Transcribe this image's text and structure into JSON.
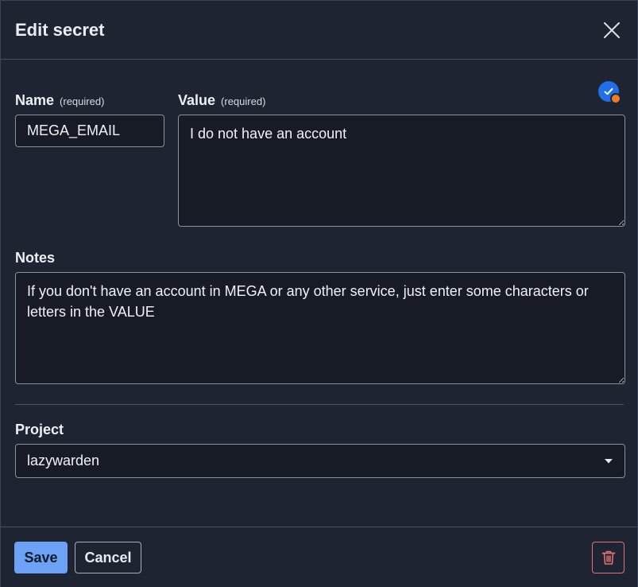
{
  "dialog": {
    "title": "Edit secret"
  },
  "form": {
    "name": {
      "label": "Name",
      "required_hint": "(required)",
      "value": "MEGA_EMAIL"
    },
    "value": {
      "label": "Value",
      "required_hint": "(required)",
      "value": "I do not have an account"
    },
    "notes": {
      "label": "Notes",
      "value": "If you don't have an account in MEGA or any other service, just enter some characters or letters in the VALUE"
    },
    "project": {
      "label": "Project",
      "selected": "lazywarden"
    }
  },
  "footer": {
    "save_label": "Save",
    "cancel_label": "Cancel"
  },
  "icons": {
    "close": "close-icon",
    "badge": "check-badge-icon",
    "dropdown": "caret-down-icon",
    "delete": "trash-icon"
  },
  "colors": {
    "background": "#1f2433",
    "field_background": "#171b26",
    "primary": "#6ca2f5",
    "danger": "#e0736f",
    "badge_blue": "#1f6fe8",
    "badge_dot": "#f07b23"
  }
}
